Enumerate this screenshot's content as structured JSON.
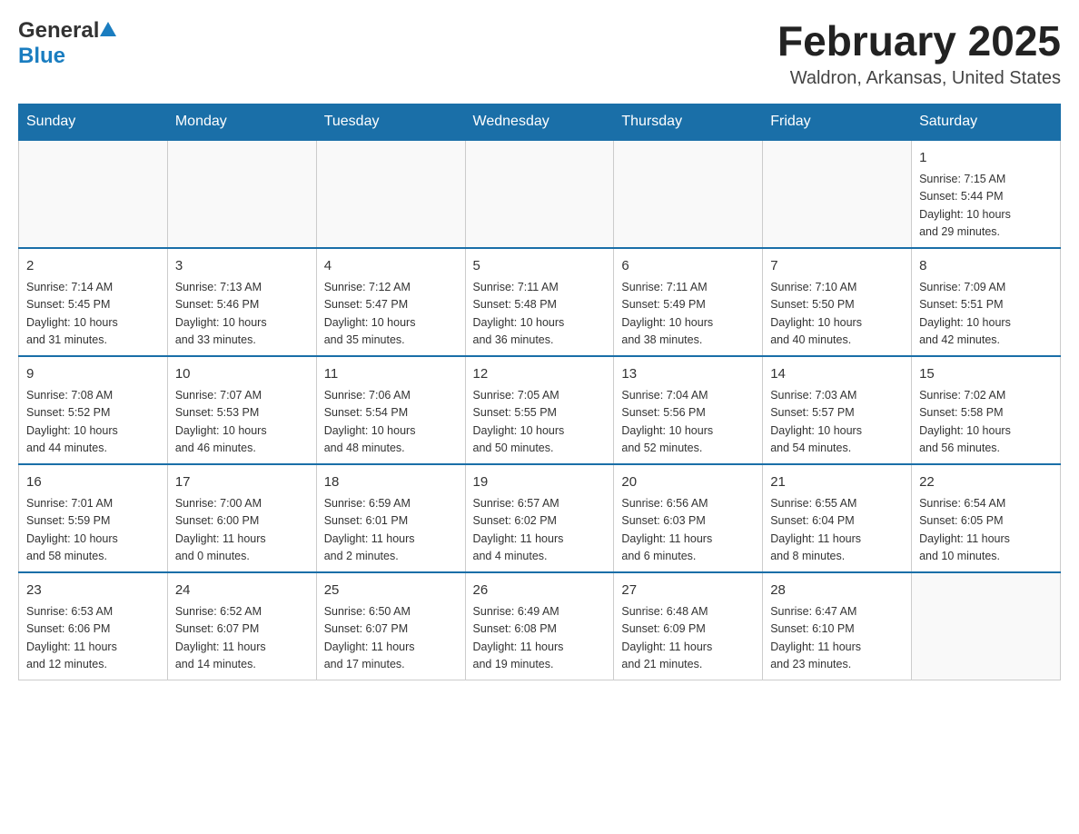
{
  "logo": {
    "text_general": "General",
    "text_blue": "Blue"
  },
  "header": {
    "month_year": "February 2025",
    "location": "Waldron, Arkansas, United States"
  },
  "weekdays": [
    "Sunday",
    "Monday",
    "Tuesday",
    "Wednesday",
    "Thursday",
    "Friday",
    "Saturday"
  ],
  "weeks": [
    [
      {
        "day": "",
        "info": ""
      },
      {
        "day": "",
        "info": ""
      },
      {
        "day": "",
        "info": ""
      },
      {
        "day": "",
        "info": ""
      },
      {
        "day": "",
        "info": ""
      },
      {
        "day": "",
        "info": ""
      },
      {
        "day": "1",
        "info": "Sunrise: 7:15 AM\nSunset: 5:44 PM\nDaylight: 10 hours\nand 29 minutes."
      }
    ],
    [
      {
        "day": "2",
        "info": "Sunrise: 7:14 AM\nSunset: 5:45 PM\nDaylight: 10 hours\nand 31 minutes."
      },
      {
        "day": "3",
        "info": "Sunrise: 7:13 AM\nSunset: 5:46 PM\nDaylight: 10 hours\nand 33 minutes."
      },
      {
        "day": "4",
        "info": "Sunrise: 7:12 AM\nSunset: 5:47 PM\nDaylight: 10 hours\nand 35 minutes."
      },
      {
        "day": "5",
        "info": "Sunrise: 7:11 AM\nSunset: 5:48 PM\nDaylight: 10 hours\nand 36 minutes."
      },
      {
        "day": "6",
        "info": "Sunrise: 7:11 AM\nSunset: 5:49 PM\nDaylight: 10 hours\nand 38 minutes."
      },
      {
        "day": "7",
        "info": "Sunrise: 7:10 AM\nSunset: 5:50 PM\nDaylight: 10 hours\nand 40 minutes."
      },
      {
        "day": "8",
        "info": "Sunrise: 7:09 AM\nSunset: 5:51 PM\nDaylight: 10 hours\nand 42 minutes."
      }
    ],
    [
      {
        "day": "9",
        "info": "Sunrise: 7:08 AM\nSunset: 5:52 PM\nDaylight: 10 hours\nand 44 minutes."
      },
      {
        "day": "10",
        "info": "Sunrise: 7:07 AM\nSunset: 5:53 PM\nDaylight: 10 hours\nand 46 minutes."
      },
      {
        "day": "11",
        "info": "Sunrise: 7:06 AM\nSunset: 5:54 PM\nDaylight: 10 hours\nand 48 minutes."
      },
      {
        "day": "12",
        "info": "Sunrise: 7:05 AM\nSunset: 5:55 PM\nDaylight: 10 hours\nand 50 minutes."
      },
      {
        "day": "13",
        "info": "Sunrise: 7:04 AM\nSunset: 5:56 PM\nDaylight: 10 hours\nand 52 minutes."
      },
      {
        "day": "14",
        "info": "Sunrise: 7:03 AM\nSunset: 5:57 PM\nDaylight: 10 hours\nand 54 minutes."
      },
      {
        "day": "15",
        "info": "Sunrise: 7:02 AM\nSunset: 5:58 PM\nDaylight: 10 hours\nand 56 minutes."
      }
    ],
    [
      {
        "day": "16",
        "info": "Sunrise: 7:01 AM\nSunset: 5:59 PM\nDaylight: 10 hours\nand 58 minutes."
      },
      {
        "day": "17",
        "info": "Sunrise: 7:00 AM\nSunset: 6:00 PM\nDaylight: 11 hours\nand 0 minutes."
      },
      {
        "day": "18",
        "info": "Sunrise: 6:59 AM\nSunset: 6:01 PM\nDaylight: 11 hours\nand 2 minutes."
      },
      {
        "day": "19",
        "info": "Sunrise: 6:57 AM\nSunset: 6:02 PM\nDaylight: 11 hours\nand 4 minutes."
      },
      {
        "day": "20",
        "info": "Sunrise: 6:56 AM\nSunset: 6:03 PM\nDaylight: 11 hours\nand 6 minutes."
      },
      {
        "day": "21",
        "info": "Sunrise: 6:55 AM\nSunset: 6:04 PM\nDaylight: 11 hours\nand 8 minutes."
      },
      {
        "day": "22",
        "info": "Sunrise: 6:54 AM\nSunset: 6:05 PM\nDaylight: 11 hours\nand 10 minutes."
      }
    ],
    [
      {
        "day": "23",
        "info": "Sunrise: 6:53 AM\nSunset: 6:06 PM\nDaylight: 11 hours\nand 12 minutes."
      },
      {
        "day": "24",
        "info": "Sunrise: 6:52 AM\nSunset: 6:07 PM\nDaylight: 11 hours\nand 14 minutes."
      },
      {
        "day": "25",
        "info": "Sunrise: 6:50 AM\nSunset: 6:07 PM\nDaylight: 11 hours\nand 17 minutes."
      },
      {
        "day": "26",
        "info": "Sunrise: 6:49 AM\nSunset: 6:08 PM\nDaylight: 11 hours\nand 19 minutes."
      },
      {
        "day": "27",
        "info": "Sunrise: 6:48 AM\nSunset: 6:09 PM\nDaylight: 11 hours\nand 21 minutes."
      },
      {
        "day": "28",
        "info": "Sunrise: 6:47 AM\nSunset: 6:10 PM\nDaylight: 11 hours\nand 23 minutes."
      },
      {
        "day": "",
        "info": ""
      }
    ]
  ]
}
